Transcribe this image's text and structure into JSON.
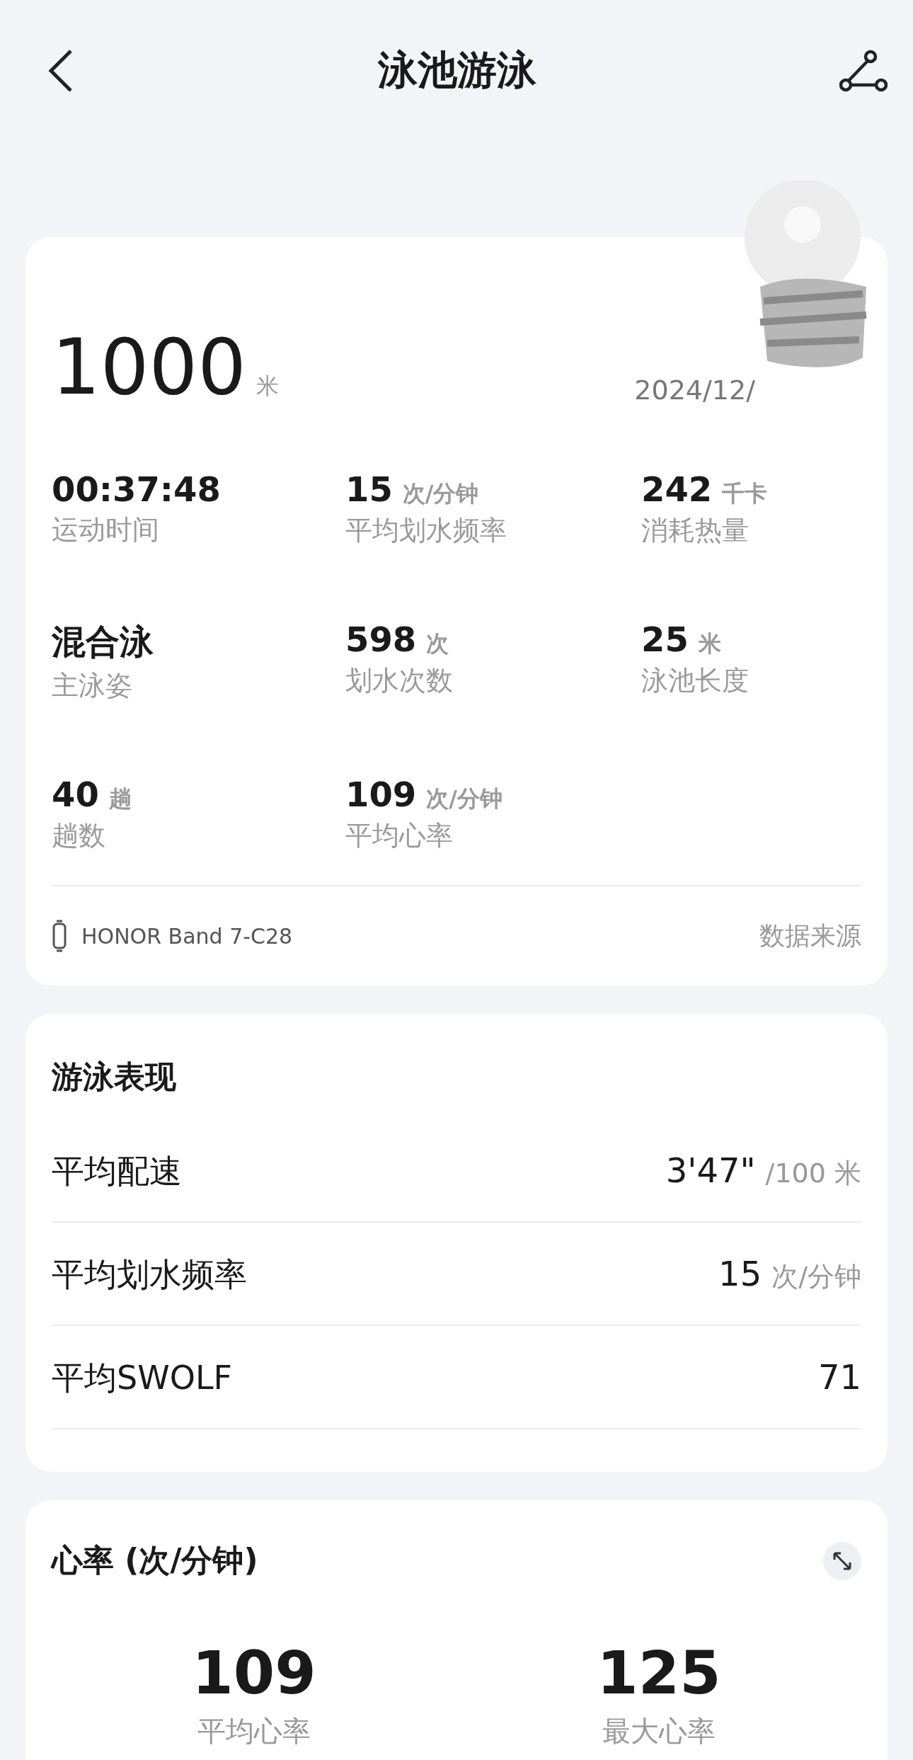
{
  "header": {
    "title": "泳池游泳"
  },
  "summary": {
    "distance": "1000",
    "distance_unit": "米",
    "date": "2024/12/",
    "stats": [
      {
        "value": "00:37:48",
        "label": "运动时间"
      },
      {
        "value": "15",
        "unit": "次/分钟",
        "label": "平均划水频率"
      },
      {
        "value": "242",
        "unit": "千卡",
        "label": "消耗热量"
      },
      {
        "value": "混合泳",
        "label": "主泳姿"
      },
      {
        "value": "598",
        "unit": "次",
        "label": "划水次数"
      },
      {
        "value": "25",
        "unit": "米",
        "label": "泳池长度"
      },
      {
        "value": "40",
        "unit": "趟",
        "label": "趟数"
      },
      {
        "value": "109",
        "unit": "次/分钟",
        "label": "平均心率"
      }
    ],
    "device": "HONOR Band 7-C28",
    "source_link": "数据来源"
  },
  "performance": {
    "title": "游泳表现",
    "rows": [
      {
        "label": "平均配速",
        "value": "3'47\"",
        "unit": "/100 米"
      },
      {
        "label": "平均划水频率",
        "value": "15",
        "unit": "次/分钟"
      },
      {
        "label": "平均SWOLF",
        "value": "71"
      }
    ]
  },
  "heart_rate": {
    "title": "心率 (次/分钟)",
    "stats": [
      {
        "value": "109",
        "label": "平均心率"
      },
      {
        "value": "125",
        "label": "最大心率"
      }
    ]
  }
}
